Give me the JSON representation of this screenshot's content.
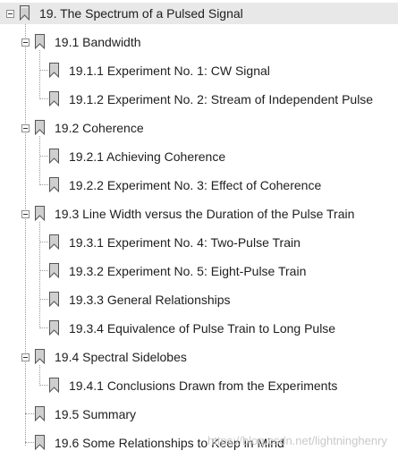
{
  "tree": {
    "items": [
      {
        "label": "19. The Spectrum of a Pulsed Signal",
        "level": 0,
        "expanded": true,
        "selected": true
      },
      {
        "label": "19.1 Bandwidth",
        "level": 1,
        "expanded": true
      },
      {
        "label": "19.1.1 Experiment No. 1: CW Signal",
        "level": 2
      },
      {
        "label": "19.1.2 Experiment No. 2: Stream of Independent Pulse",
        "level": 2
      },
      {
        "label": "19.2 Coherence",
        "level": 1,
        "expanded": true
      },
      {
        "label": "19.2.1 Achieving Coherence",
        "level": 2
      },
      {
        "label": "19.2.2 Experiment No. 3: Effect of Coherence",
        "level": 2
      },
      {
        "label": "19.3 Line Width versus the Duration of the Pulse Train",
        "level": 1,
        "expanded": true
      },
      {
        "label": "19.3.1 Experiment No. 4: Two-Pulse Train",
        "level": 2
      },
      {
        "label": "19.3.2 Experiment No. 5: Eight-Pulse Train",
        "level": 2
      },
      {
        "label": "19.3.3 General Relationships",
        "level": 2
      },
      {
        "label": "19.3.4 Equivalence of Pulse Train to Long Pulse",
        "level": 2
      },
      {
        "label": "19.4 Spectral Sidelobes",
        "level": 1,
        "expanded": true
      },
      {
        "label": "19.4.1 Conclusions Drawn from the Experiments",
        "level": 2
      },
      {
        "label": "19.5 Summary",
        "level": 1
      },
      {
        "label": "19.6 Some Relationships to Keep in Mind",
        "level": 1
      }
    ]
  },
  "watermark": "https://blog.csdn.net/lightninghenry",
  "icons": {
    "toggle": "collapse-minus-icon",
    "bookmark": "bookmark-icon"
  },
  "colors": {
    "selected_row": "#e8e8e8",
    "text": "#1e1e1e",
    "connector": "#9a9a9a"
  }
}
